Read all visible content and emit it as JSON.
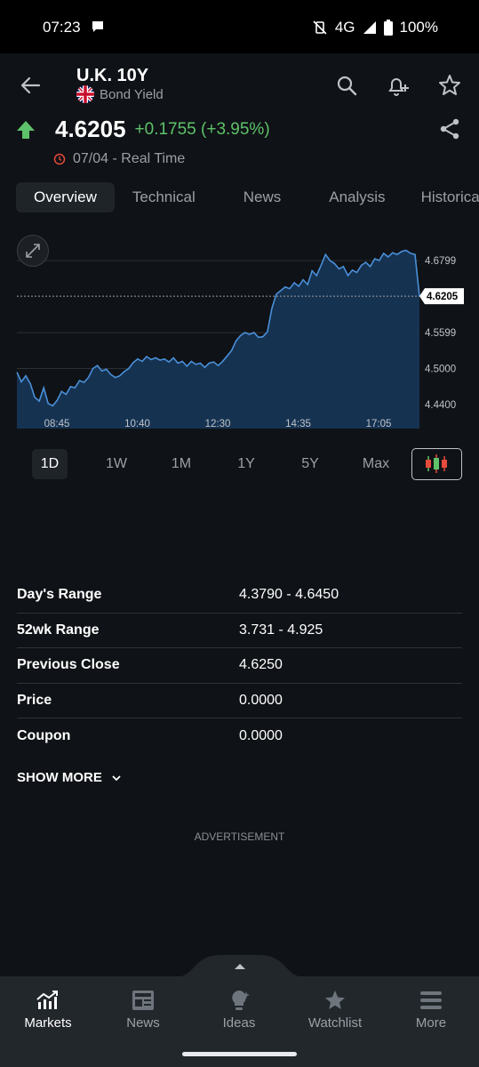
{
  "status": {
    "time": "07:23",
    "network": "4G",
    "battery": "100%"
  },
  "header": {
    "title": "U.K. 10Y",
    "subtitle": "Bond Yield",
    "price": "4.6205",
    "change": "+0.1755 (+3.95%)",
    "date": "07/04 - Real Time",
    "colors": {
      "up": "#5ec26a",
      "accent_red": "#e64b3c"
    }
  },
  "tabs": [
    {
      "label": "Overview",
      "active": true
    },
    {
      "label": "Technical"
    },
    {
      "label": "News"
    },
    {
      "label": "Analysis"
    },
    {
      "label": "Historical"
    }
  ],
  "chart_data": {
    "type": "area",
    "x_ticks": [
      "08:45",
      "10:40",
      "12:30",
      "14:35",
      "17:05"
    ],
    "y_ticks": [
      4.6799,
      4.5599,
      4.5,
      4.44
    ],
    "current_label": "4.6205",
    "ylim": [
      4.4,
      4.72
    ],
    "x": [
      0,
      1,
      2,
      3,
      4,
      5,
      6,
      7,
      8,
      9,
      10,
      11,
      12,
      13,
      14,
      15,
      16,
      17,
      18,
      19,
      20,
      21,
      22,
      23,
      24,
      25,
      26,
      27,
      28,
      29,
      30,
      31,
      32,
      33,
      34,
      35,
      36,
      37,
      38,
      39,
      40,
      41,
      42,
      43,
      44,
      45,
      46,
      47,
      48,
      49,
      50,
      51,
      52,
      53,
      54,
      55,
      56,
      57,
      58,
      59,
      60,
      61,
      62,
      63,
      64,
      65,
      66,
      67,
      68,
      69,
      70,
      71,
      72,
      73,
      74,
      75,
      76,
      77,
      78,
      79,
      80,
      81,
      82,
      83,
      84,
      85,
      86,
      87,
      88,
      89,
      90
    ],
    "values": [
      4.494,
      4.478,
      4.488,
      4.475,
      4.452,
      4.446,
      4.468,
      4.442,
      4.438,
      4.447,
      4.462,
      4.457,
      4.47,
      4.468,
      4.48,
      4.477,
      4.485,
      4.5,
      4.505,
      4.496,
      4.499,
      4.49,
      4.485,
      4.488,
      4.495,
      4.5,
      4.51,
      4.516,
      4.512,
      4.52,
      4.515,
      4.518,
      4.514,
      4.516,
      4.511,
      4.518,
      4.509,
      4.512,
      4.504,
      4.512,
      4.507,
      4.509,
      4.502,
      4.509,
      4.511,
      4.505,
      4.512,
      4.521,
      4.53,
      4.546,
      4.555,
      4.56,
      4.557,
      4.56,
      4.552,
      4.553,
      4.561,
      4.6,
      4.624,
      4.63,
      4.636,
      4.633,
      4.643,
      4.637,
      4.648,
      4.64,
      4.663,
      4.655,
      4.672,
      4.69,
      4.68,
      4.675,
      4.666,
      4.67,
      4.655,
      4.664,
      4.66,
      4.672,
      4.677,
      4.67,
      4.683,
      4.68,
      4.692,
      4.686,
      4.693,
      4.69,
      4.695,
      4.697,
      4.692,
      4.69,
      4.6205
    ],
    "colors": {
      "line": "#4a90d9",
      "fill": "#173554"
    }
  },
  "ranges": [
    "1D",
    "1W",
    "1M",
    "1Y",
    "5Y",
    "Max"
  ],
  "stats": [
    {
      "label": "Day's Range",
      "value": "4.3790 - 4.6450"
    },
    {
      "label": "52wk Range",
      "value": "3.731 - 4.925"
    },
    {
      "label": "Previous Close",
      "value": "4.6250"
    },
    {
      "label": "Price",
      "value": "0.0000"
    },
    {
      "label": "Coupon",
      "value": "0.0000"
    }
  ],
  "show_more": "SHOW MORE",
  "advertisement": "ADVERTISEMENT",
  "nav": [
    {
      "label": "Markets",
      "icon": "markets-icon",
      "active": true
    },
    {
      "label": "News",
      "icon": "news-icon"
    },
    {
      "label": "Ideas",
      "icon": "ideas-icon"
    },
    {
      "label": "Watchlist",
      "icon": "watchlist-icon"
    },
    {
      "label": "More",
      "icon": "more-icon"
    }
  ]
}
